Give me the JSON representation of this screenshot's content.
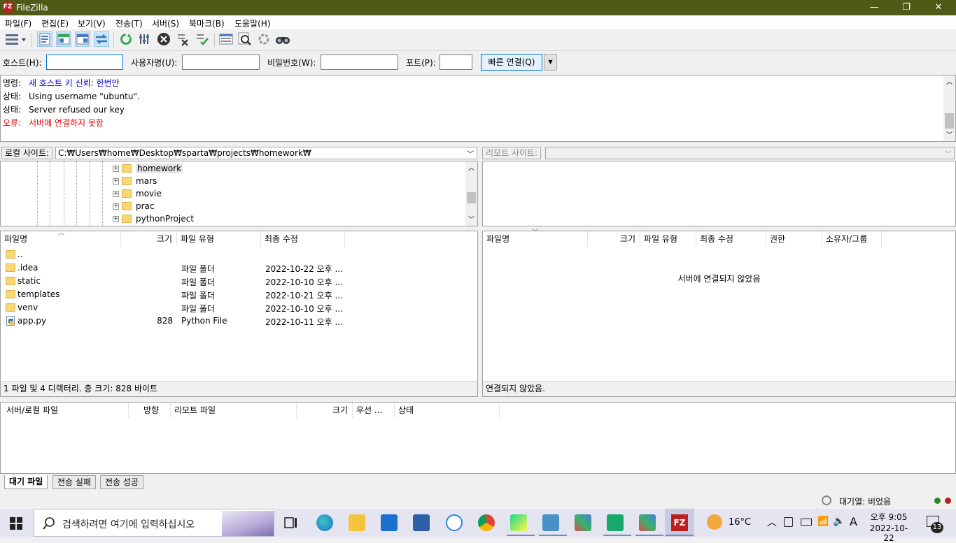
{
  "window": {
    "title": "FileZilla",
    "logo_text": "FZ",
    "min": "—",
    "max": "❐",
    "close": "✕"
  },
  "menu": [
    "파일(F)",
    "편집(E)",
    "보기(V)",
    "전송(T)",
    "서버(S)",
    "북마크(B)",
    "도움말(H)"
  ],
  "quickconnect": {
    "host_label": "호스트(H):",
    "host_value": "",
    "user_label": "사용자명(U):",
    "user_value": "",
    "pass_label": "비밀번호(W):",
    "pass_value": "",
    "port_label": "포트(P):",
    "port_value": "",
    "connect_label": "빠른 연결(Q)"
  },
  "log": [
    {
      "label": "명령:",
      "text": "새 호스트 키 신뢰: 한번만",
      "color": "#0000cc"
    },
    {
      "label": "상태:",
      "text": "Using username \"ubuntu\".",
      "color": "#000000"
    },
    {
      "label": "상태:",
      "text": "Server refused our key",
      "color": "#000000"
    },
    {
      "label": "오류:",
      "text": "서버에 연결하지 못함",
      "color": "#e00000"
    }
  ],
  "local": {
    "site_label": "로컬 사이트:",
    "path": "C:₩Users₩home₩Desktop₩sparta₩projects₩homework₩",
    "tree": [
      "homework",
      "mars",
      "movie",
      "prac",
      "pythonProject"
    ],
    "columns": [
      "파일명",
      "크기",
      "파일 유형",
      "최종 수정"
    ],
    "files": [
      {
        "name": "..",
        "size": "",
        "type": "",
        "modified": "",
        "icon": "folder-icon"
      },
      {
        "name": ".idea",
        "size": "",
        "type": "파일 폴더",
        "modified": "2022-10-22 오후 ...",
        "icon": "folder-icon"
      },
      {
        "name": "static",
        "size": "",
        "type": "파일 폴더",
        "modified": "2022-10-10 오후 ...",
        "icon": "folder-icon"
      },
      {
        "name": "templates",
        "size": "",
        "type": "파일 폴더",
        "modified": "2022-10-21 오후 ...",
        "icon": "folder-icon"
      },
      {
        "name": "venv",
        "size": "",
        "type": "파일 폴더",
        "modified": "2022-10-10 오후 ...",
        "icon": "folder-icon"
      },
      {
        "name": "app.py",
        "size": "828",
        "type": "Python File",
        "modified": "2022-10-11 오후 ...",
        "icon": "python-file-icon"
      }
    ],
    "status": "1 파일 및 4 디렉터리. 총 크기: 828 바이트"
  },
  "remote": {
    "site_label": "리모트 사이트:",
    "columns": [
      "파일명",
      "크기",
      "파일 유형",
      "최종 수정",
      "권한",
      "소유자/그룹"
    ],
    "empty_message": "서버에 연결되지 않았음",
    "status": "연결되지 않았음."
  },
  "queue": {
    "columns": [
      "서버/로컬 파일",
      "방향",
      "리모트 파일",
      "크기",
      "우선 ...",
      "상태"
    ],
    "tabs": [
      "대기 파일",
      "전송 실패",
      "전송 성공"
    ]
  },
  "bottom_status": {
    "queue_text": "대기열: 비었음"
  },
  "taskbar": {
    "search_placeholder": "검색하려면 여기에 입력하십시오",
    "weather": "16°C",
    "ime": "A",
    "time": "오후 9:05",
    "date": "2022-10-22",
    "notifications": "13"
  }
}
